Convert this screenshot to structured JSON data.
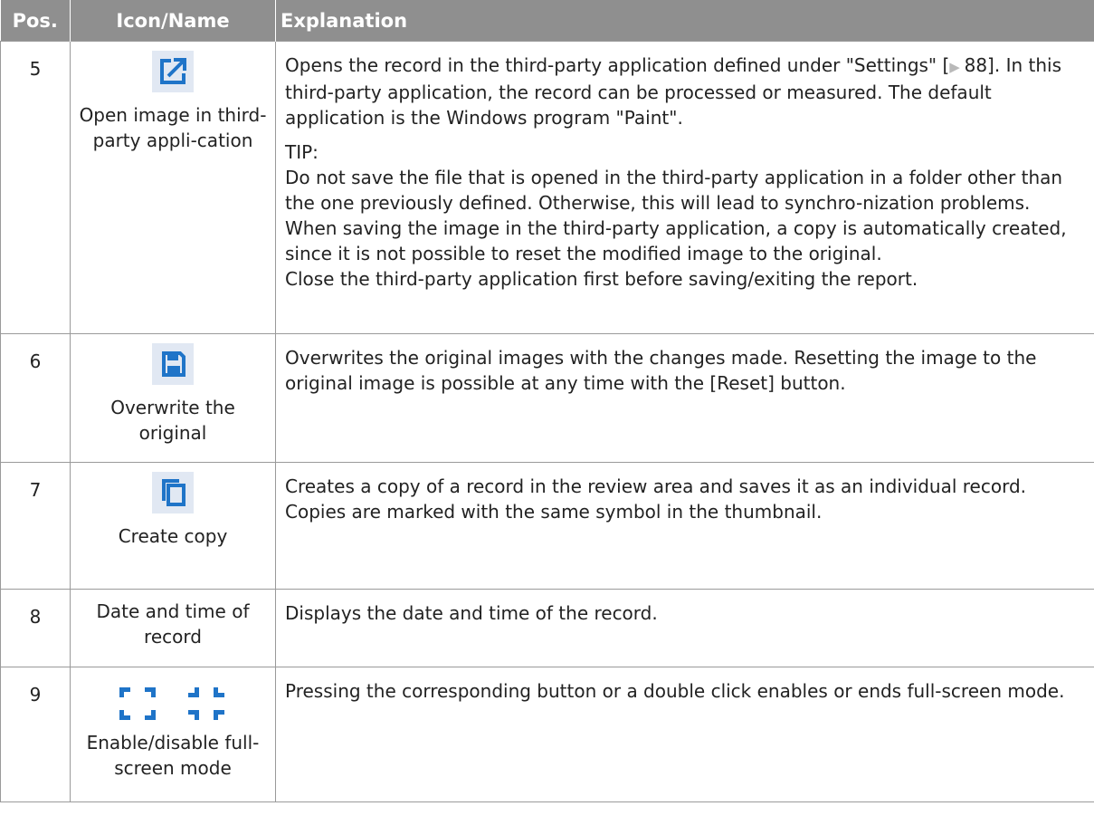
{
  "header": {
    "pos": "Pos.",
    "icon_name": "Icon/Name",
    "explanation": "Explanation"
  },
  "rows": [
    {
      "pos": "5",
      "icon": "open-external-icon",
      "name": "Open image in third-party appli-cation",
      "explanation": [
        "Opens the record in the third-party application defined under \"Settings\" [",
        "88]. In this third-party application, the record can be processed or measured. The default application is the Windows program \"Paint\"."
      ],
      "tip_label": "TIP:",
      "tip_lines": [
        "Do not save the file that is opened in the third-party application in a folder other than the one previously defined. Otherwise, this will lead to synchro-nization problems.",
        "When saving the image in the third-party application, a copy is automatically created, since it is not possible to reset the modified image to the original.",
        "Close the third-party application first before saving/exiting the report."
      ]
    },
    {
      "pos": "6",
      "icon": "save-disk-icon",
      "name": "Overwrite the original",
      "explanation": "Overwrites the original images with the changes made. Resetting the image to the original image is possible at any time with the [Reset] button."
    },
    {
      "pos": "7",
      "icon": "copy-icon",
      "name": "Create copy",
      "explanation": "Creates a copy of a record in the review area and saves it as an individual record. Copies are marked with the same symbol in the thumbnail."
    },
    {
      "pos": "8",
      "name": "Date and time of record",
      "explanation": "Displays the date and time of the record."
    },
    {
      "pos": "9",
      "icon": "fullscreen-toggle-icon",
      "name": "Enable/disable full-screen mode",
      "explanation": "Pressing the corresponding button or a double click enables or ends full-screen mode."
    }
  ],
  "colors": {
    "header_bg": "#8f8f8f",
    "icon_bg": "#e1e8f3",
    "icon_fg": "#1f74c8",
    "border": "#9a9a9a"
  }
}
